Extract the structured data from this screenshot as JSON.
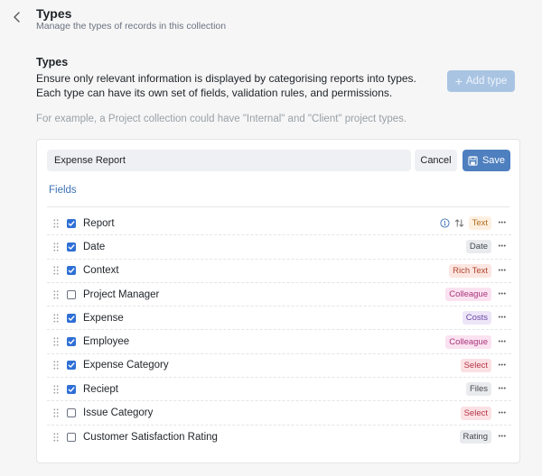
{
  "header": {
    "title": "Types",
    "subtitle": "Manage the types of records in this collection"
  },
  "section": {
    "title": "Types",
    "description": "Ensure only relevant information is displayed by categorising reports into types. Each type can have its own set of fields, validation rules, and permissions.",
    "add_button_label": "Add type",
    "example": "For example, a Project collection could have \"Internal\" and \"Client\" project types."
  },
  "editor": {
    "name_value": "Expense Report",
    "cancel_label": "Cancel",
    "save_label": "Save",
    "tab_label": "Fields"
  },
  "colors": {
    "accent": "#4e7fbf",
    "add_button_disabled": "#a9c4e3"
  },
  "fields": [
    {
      "label": "Report",
      "checked": true,
      "type": "Text",
      "type_bg": "#fdf0e0",
      "type_fg": "#b26b1d",
      "extras": true
    },
    {
      "label": "Date",
      "checked": true,
      "type": "Date",
      "type_bg": "#e9ebee",
      "type_fg": "#444a52",
      "extras": false
    },
    {
      "label": "Context",
      "checked": true,
      "type": "Rich Text",
      "type_bg": "#fce6e1",
      "type_fg": "#b0442f",
      "extras": false
    },
    {
      "label": "Project Manager",
      "checked": false,
      "type": "Colleague",
      "type_bg": "#fbe2f1",
      "type_fg": "#a8357a",
      "extras": false
    },
    {
      "label": "Expense",
      "checked": true,
      "type": "Costs",
      "type_bg": "#ede6f8",
      "type_fg": "#6b4aa5",
      "extras": false
    },
    {
      "label": "Employee",
      "checked": true,
      "type": "Colleague",
      "type_bg": "#fbe2f1",
      "type_fg": "#a8357a",
      "extras": false
    },
    {
      "label": "Expense Category",
      "checked": true,
      "type": "Select",
      "type_bg": "#fbe1e4",
      "type_fg": "#b53849",
      "extras": false
    },
    {
      "label": "Reciept",
      "checked": true,
      "type": "Files",
      "type_bg": "#e9ebee",
      "type_fg": "#444a52",
      "extras": false
    },
    {
      "label": "Issue Category",
      "checked": false,
      "type": "Select",
      "type_bg": "#fbe1e4",
      "type_fg": "#b53849",
      "extras": false
    },
    {
      "label": "Customer Satisfaction Rating",
      "checked": false,
      "type": "Rating",
      "type_bg": "#e9ebee",
      "type_fg": "#444a52",
      "extras": false
    }
  ],
  "icons": {
    "back": "chevron-left-icon",
    "add": "plus-icon",
    "save": "floppy-disk-icon",
    "drag": "drag-handle-icon",
    "info": "info-circle-icon",
    "sort": "sort-arrows-icon",
    "more": "ellipsis-icon"
  }
}
